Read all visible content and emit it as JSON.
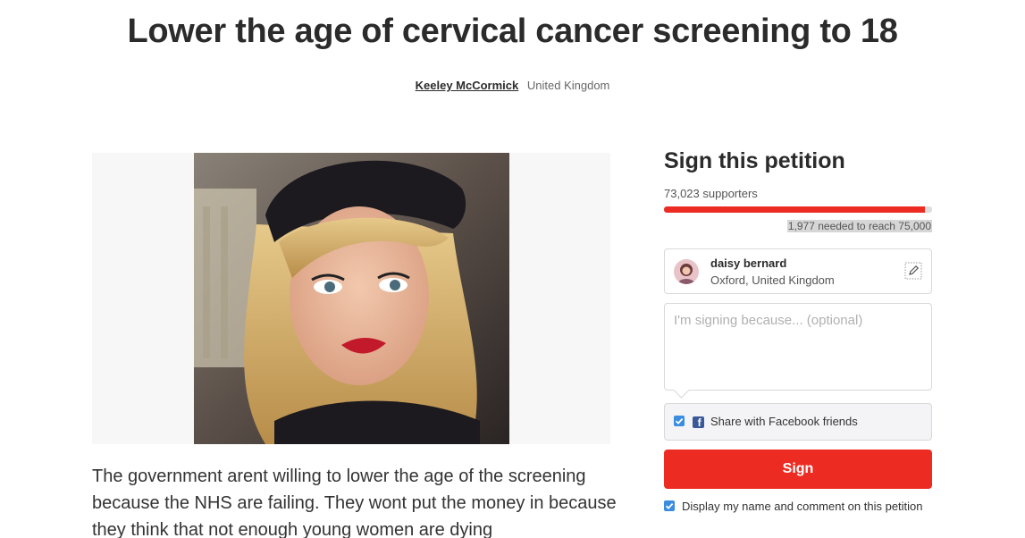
{
  "petition": {
    "title": "Lower the age of cervical cancer screening to 18",
    "author": "Keeley McCormick",
    "author_location": "United Kingdom",
    "body_text": "The government arent willing to lower the age of the screening because the NHS are failing. They wont put the money in because they think that not enough young women are dying"
  },
  "sidebar": {
    "heading": "Sign this petition",
    "supporters": "73,023 supporters",
    "progress_fraction": 0.9736,
    "needed": "1,977 needed to reach 75,000",
    "signer": {
      "name": "daisy bernard",
      "location": "Oxford, United Kingdom"
    },
    "comment_placeholder": "I'm signing because... (optional)",
    "facebook_share_label": "Share with Facebook friends",
    "facebook_share_checked": true,
    "sign_button_label": "Sign",
    "display_name_label": "Display my name and comment on this petition",
    "display_name_checked": true
  },
  "colors": {
    "accent_red": "#ec2c22",
    "checkbox_blue": "#3a8de0",
    "facebook_blue": "#3b5998"
  },
  "icons": {
    "edit": "edit-pencil-icon",
    "facebook": "facebook-icon",
    "checkbox": "checkmark-icon"
  }
}
